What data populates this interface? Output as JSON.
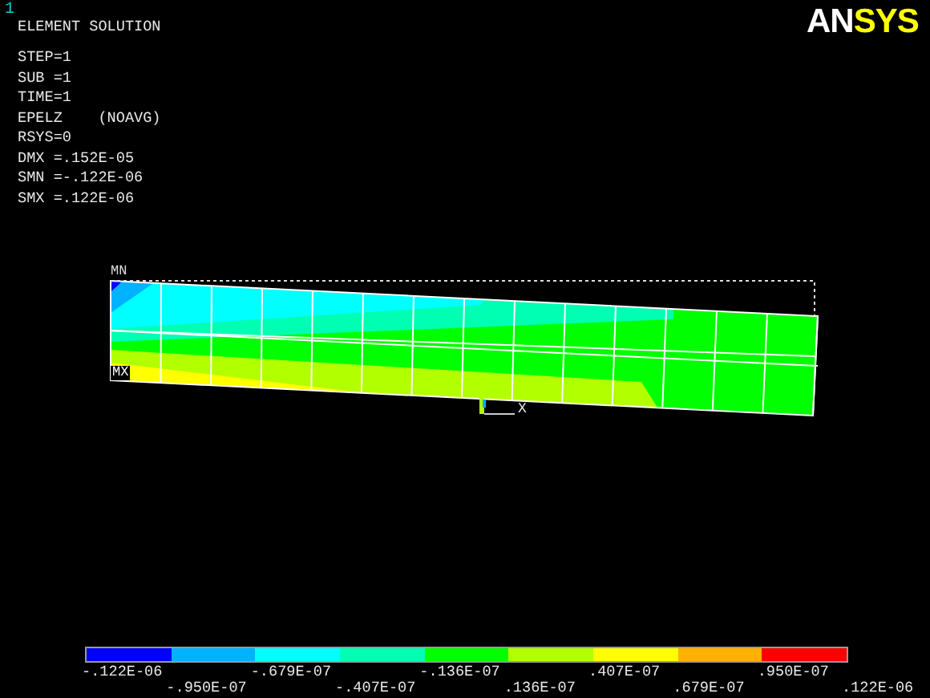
{
  "window_number": "1",
  "logo": {
    "parts": [
      {
        "text": "AN",
        "color": "#ffffff"
      },
      {
        "text": "SYS",
        "color": "#ffff00"
      }
    ]
  },
  "title": "ELEMENT SOLUTION",
  "info_lines": [
    "STEP=1",
    "SUB =1",
    "TIME=1",
    "EPELZ    (NOAVG)",
    "RSYS=0",
    "DMX =.152E-05",
    "SMN =-.122E-06",
    "SMX =.122E-06"
  ],
  "plot": {
    "min_marker": "MN",
    "max_marker": "MX",
    "axis_label": "X"
  },
  "legend": {
    "bands": [
      {
        "color": "#0000ff"
      },
      {
        "color": "#00b2ff"
      },
      {
        "color": "#00ffff"
      },
      {
        "color": "#00ffb2"
      },
      {
        "color": "#00ff00"
      },
      {
        "color": "#b2ff00"
      },
      {
        "color": "#ffff00"
      },
      {
        "color": "#ffb200"
      },
      {
        "color": "#ff0000"
      }
    ],
    "labels": [
      "-.122E-06",
      "-.950E-07",
      "-.679E-07",
      "-.407E-07",
      "-.136E-07",
      ".136E-07",
      ".407E-07",
      ".679E-07",
      ".950E-07",
      ".122E-06"
    ]
  }
}
